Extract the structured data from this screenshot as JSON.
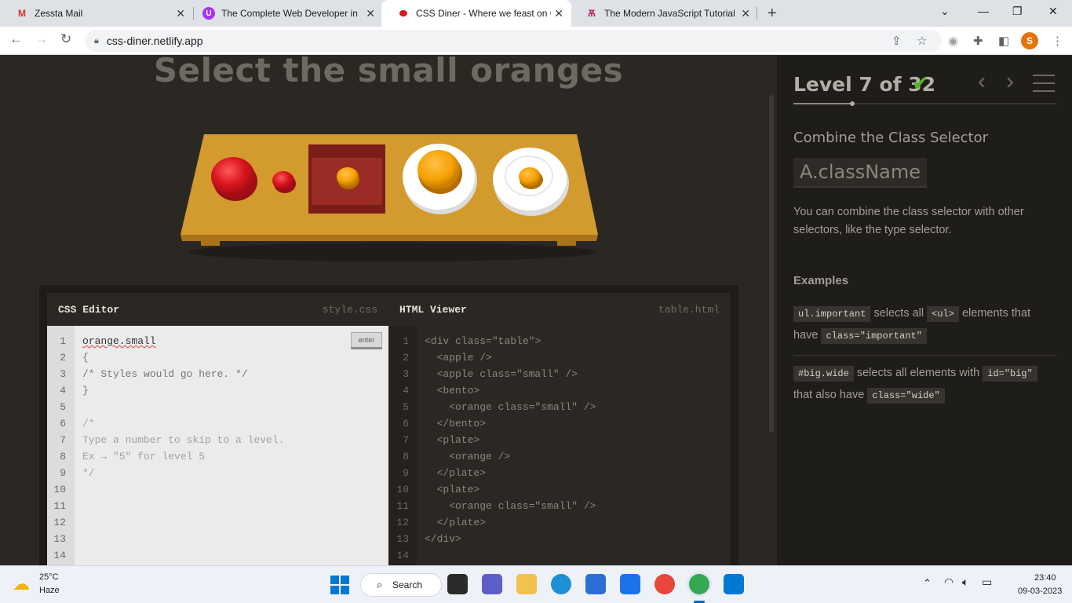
{
  "browser": {
    "tabs": [
      {
        "title": "Zessta Mail"
      },
      {
        "title": "The Complete Web Developer in"
      },
      {
        "title": "CSS Diner - Where we feast on C"
      },
      {
        "title": "The Modern JavaScript Tutorial"
      }
    ],
    "url": "css-diner.netlify.app",
    "profile_initial": "S"
  },
  "page": {
    "instruction": "Select the small oranges"
  },
  "editor": {
    "css_title": "CSS Editor",
    "css_file": "style.css",
    "html_title": "HTML Viewer",
    "html_file": "table.html",
    "enter_label": "enter",
    "line_numbers": [
      "1",
      "2",
      "3",
      "4",
      "5",
      "6",
      "7",
      "8",
      "9",
      "10",
      "11",
      "12",
      "13",
      "14"
    ],
    "css_lines": [
      "orange.small",
      "{",
      "/* Styles would go here. */",
      "}",
      "",
      "/*",
      "Type a number to skip to a level.",
      "Ex → \"5\" for level 5",
      "*/"
    ],
    "html_lines": [
      "<div class=\"table\">",
      "  <apple />",
      "  <apple class=\"small\" />",
      "  <bento>",
      "    <orange class=\"small\" />",
      "  </bento>",
      "  <plate>",
      "    <orange />",
      "  </plate>",
      "  <plate>",
      "    <orange class=\"small\" />",
      "  </plate>",
      "</div>"
    ]
  },
  "sidebar": {
    "level": "Level 7 of 32",
    "selector_name": "Combine the Class Selector",
    "syntax": "A.className",
    "hint": "You can combine the class selector with other selectors, like the type selector.",
    "examples_title": "Examples",
    "example1": {
      "code1": "ul.important",
      "t1": " selects all ",
      "code2": "<ul>",
      "t2": " elements that have ",
      "code3": "class=\"important\""
    },
    "example2": {
      "code1": "#big.wide",
      "t1": " selects all elements with ",
      "code2": "id=\"big\"",
      "t2": " that also have ",
      "code3": "class=\"wide\""
    }
  },
  "taskbar": {
    "temperature": "25°C",
    "condition": "Haze",
    "search_label": "Search",
    "time": "23:40",
    "date": "09-03-2023"
  },
  "colors": {
    "page_bg": "#2b2824",
    "sidebar_bg": "#1f1d1a",
    "table_wood": "#d39b2d",
    "apple_red": "#d8151f",
    "orange": "#f5a100",
    "check_green": "#4cbb17"
  }
}
